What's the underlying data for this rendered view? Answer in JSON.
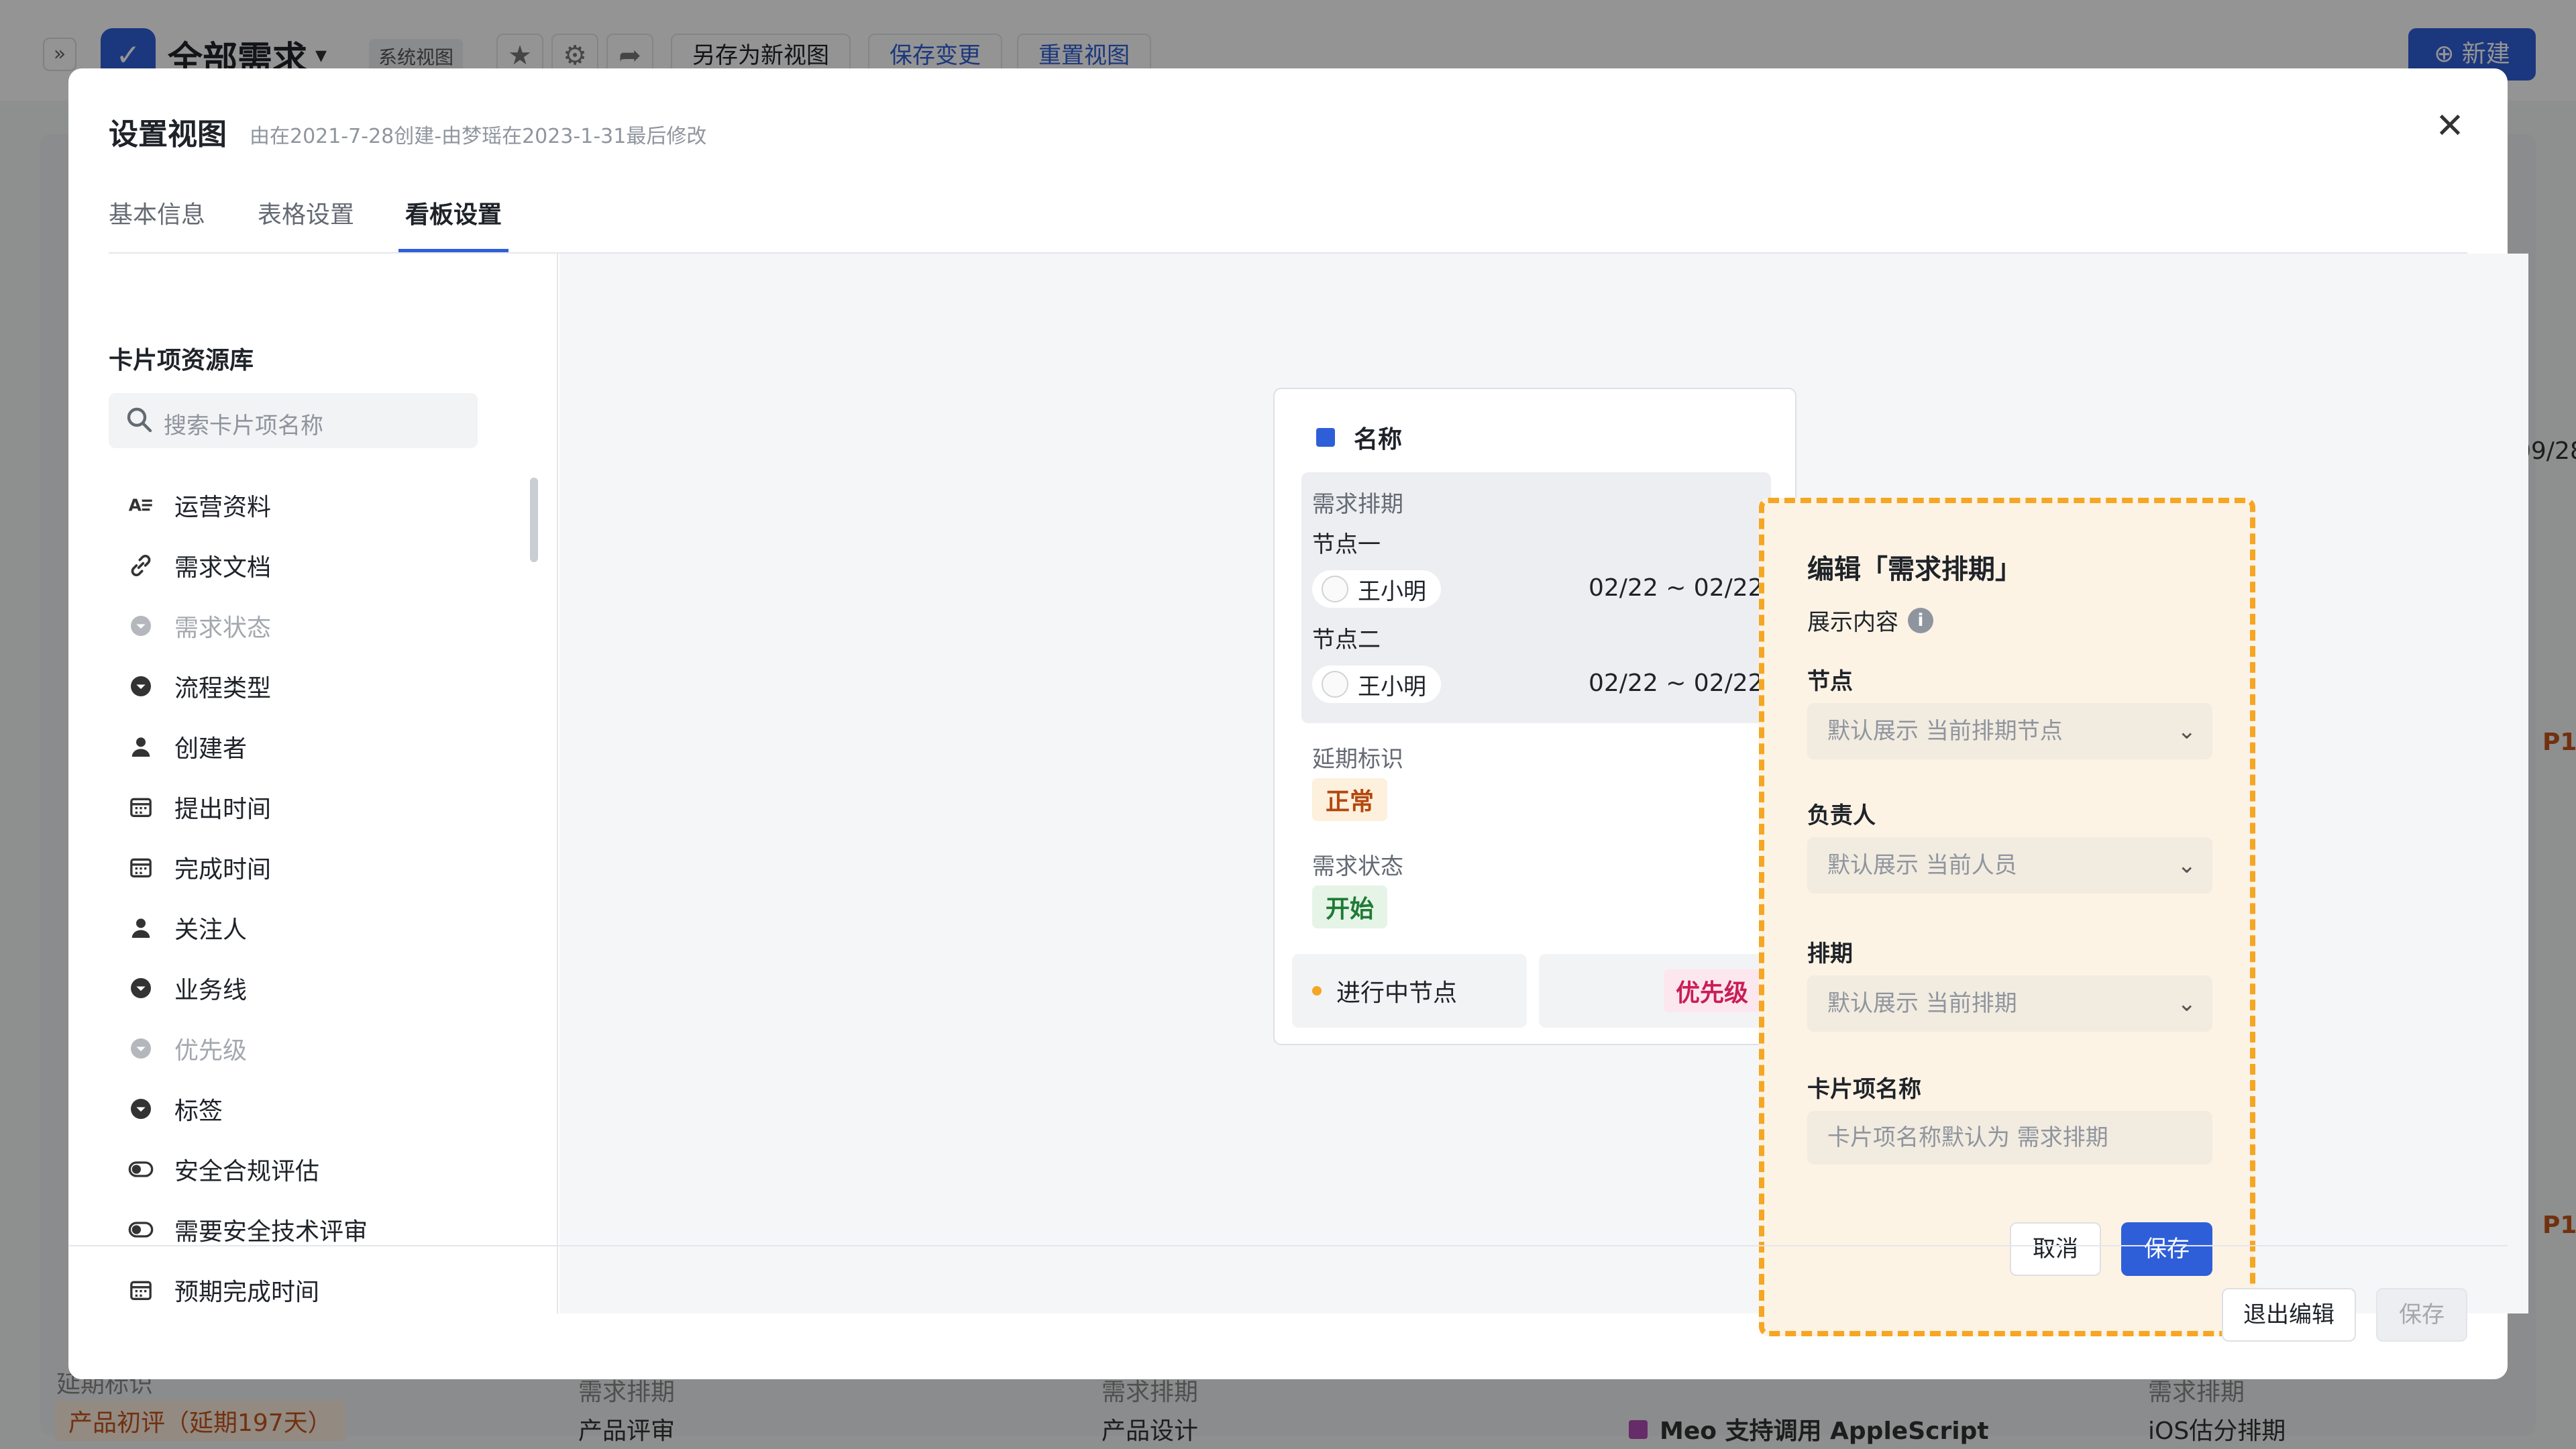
{
  "background": {
    "sidebar_toggle": "»",
    "view_title": "全部需求",
    "view_tag": "系统视图",
    "save_as_new": "另存为新视图",
    "save_changes": "保存变更",
    "reset_view": "重置视图",
    "new_button": "新建",
    "date_fragment": "09/28",
    "priority_fragment_1": "P1",
    "priority_fragment_2": "P1",
    "delay_badge": "产品初评（延期197天）",
    "col_items": [
      "需求排期",
      "需求排期",
      "需求排期"
    ],
    "col_values": [
      "产品评审",
      "产品设计",
      "iOS估分排期"
    ],
    "card_title": "Meo 支持调用 AppleScript",
    "delay_label": "延期标识"
  },
  "modal": {
    "title": "设置视图",
    "subtitle": "由在2021-7-28创建-由梦瑶在2023-1-31最后修改",
    "close": "✕",
    "tabs": [
      "基本信息",
      "表格设置",
      "看板设置"
    ],
    "active_tab": "看板设置"
  },
  "library": {
    "title": "卡片项资源库",
    "search_placeholder": "搜索卡片项名称",
    "items": [
      {
        "label": "运营资料",
        "icon": "text-icon",
        "disabled": false
      },
      {
        "label": "需求文档",
        "icon": "link-icon",
        "disabled": false
      },
      {
        "label": "需求状态",
        "icon": "dropdown-icon",
        "disabled": true
      },
      {
        "label": "流程类型",
        "icon": "dropdown-icon",
        "disabled": false
      },
      {
        "label": "创建者",
        "icon": "user-icon",
        "disabled": false
      },
      {
        "label": "提出时间",
        "icon": "calendar-icon",
        "disabled": false
      },
      {
        "label": "完成时间",
        "icon": "calendar-icon",
        "disabled": false
      },
      {
        "label": "关注人",
        "icon": "user-icon",
        "disabled": false
      },
      {
        "label": "业务线",
        "icon": "dropdown-icon",
        "disabled": false
      },
      {
        "label": "优先级",
        "icon": "dropdown-icon",
        "disabled": true
      },
      {
        "label": "标签",
        "icon": "dropdown-icon",
        "disabled": false
      },
      {
        "label": "安全合规评估",
        "icon": "toggle-icon",
        "disabled": false
      },
      {
        "label": "需要安全技术评审",
        "icon": "toggle-icon",
        "disabled": false
      },
      {
        "label": "预期完成时间",
        "icon": "calendar-icon",
        "disabled": false
      }
    ]
  },
  "card": {
    "name_label": "名称",
    "schedule_label": "需求排期",
    "node1": "节点一",
    "node2": "节点二",
    "person": "王小明",
    "date_range": "02/22 ~ 02/22",
    "delay_label": "延期标识",
    "delay_value": "正常",
    "status_label": "需求状态",
    "status_value": "开始",
    "foot_node": "进行中节点",
    "foot_priority": "优先级"
  },
  "editor": {
    "title": "编辑「需求排期」",
    "display_label": "展示内容",
    "info_icon": "i",
    "node_label": "节点",
    "node_value": "默认展示 当前排期节点",
    "owner_label": "负责人",
    "owner_value": "默认展示 当前人员",
    "schedule_label": "排期",
    "schedule_value": "默认展示 当前排期",
    "name_label": "卡片项名称",
    "name_placeholder": "卡片项名称默认为 需求排期",
    "cancel": "取消",
    "save": "保存"
  },
  "footer": {
    "exit": "退出编辑",
    "save": "保存"
  },
  "colors": {
    "primary": "#2f5fd8",
    "editor_border": "#f5a623",
    "editor_bg": "#fdf3e5",
    "normal_badge_bg": "#fdf0dc",
    "normal_badge_text": "#b4480f",
    "start_badge_bg": "#e5f4e7",
    "start_badge_text": "#1f7a34",
    "priority_badge_bg": "#fde7ee",
    "priority_badge_text": "#c91e58"
  }
}
